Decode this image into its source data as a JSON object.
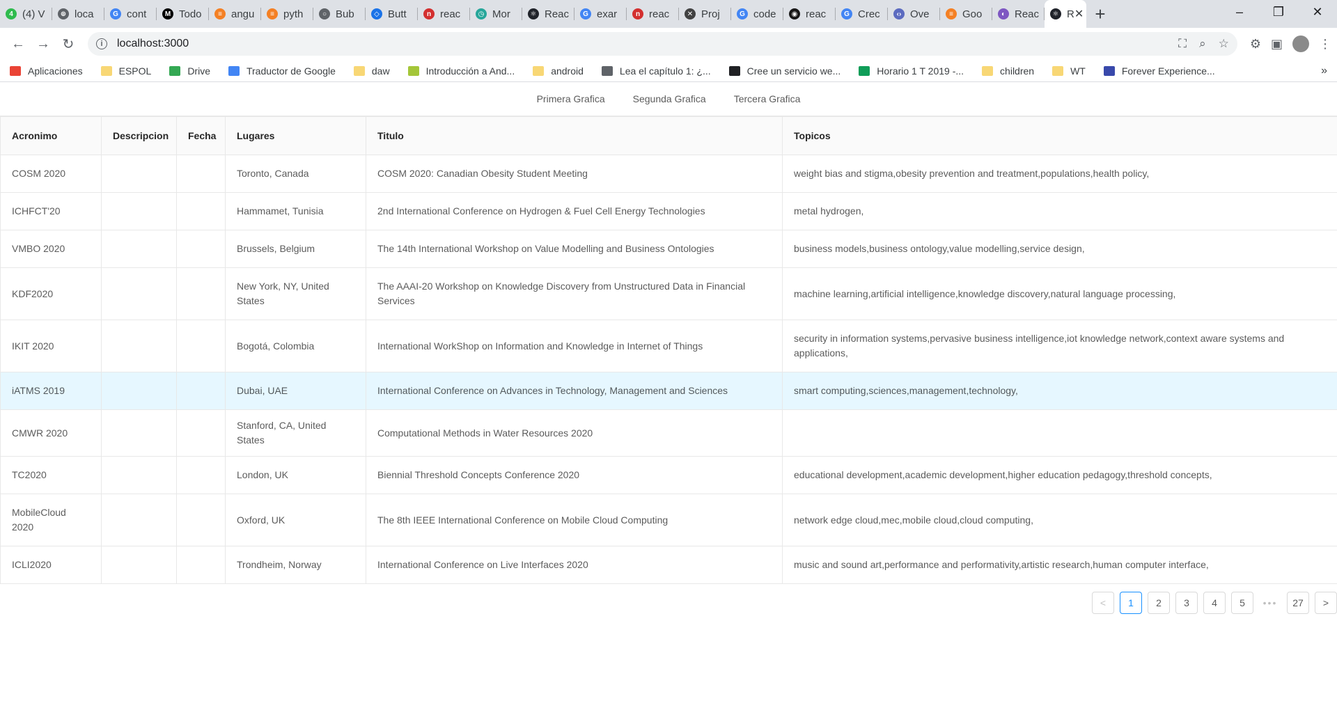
{
  "browser": {
    "tabs": [
      {
        "title": "(4) V",
        "color": "#2fbb4e",
        "glyph": "4"
      },
      {
        "title": "loca",
        "color": "#5f6368",
        "glyph": "⊕"
      },
      {
        "title": "cont",
        "color": "#4285f4",
        "glyph": "G"
      },
      {
        "title": "Todo",
        "color": "#000000",
        "glyph": "M"
      },
      {
        "title": "angu",
        "color": "#f48024",
        "glyph": "≡"
      },
      {
        "title": "pyth",
        "color": "#f48024",
        "glyph": "≡"
      },
      {
        "title": "Bub",
        "color": "#5f6368",
        "glyph": "○"
      },
      {
        "title": "Butt",
        "color": "#1a73e8",
        "glyph": "◇"
      },
      {
        "title": "reac",
        "color": "#d32f2f",
        "glyph": "n"
      },
      {
        "title": "Mor",
        "color": "#26a69a",
        "glyph": "◷"
      },
      {
        "title": "Reac",
        "color": "#20232a",
        "glyph": "⚛"
      },
      {
        "title": "exar",
        "color": "#4285f4",
        "glyph": "G"
      },
      {
        "title": "reac",
        "color": "#d32f2f",
        "glyph": "n"
      },
      {
        "title": "Proj",
        "color": "#424242",
        "glyph": "✕"
      },
      {
        "title": "code",
        "color": "#4285f4",
        "glyph": "G"
      },
      {
        "title": "reac",
        "color": "#181717",
        "glyph": "◉"
      },
      {
        "title": "Crec",
        "color": "#4285f4",
        "glyph": "G"
      },
      {
        "title": "Ove",
        "color": "#5c6bc0",
        "glyph": "‹›"
      },
      {
        "title": "Goo",
        "color": "#f48024",
        "glyph": "≡"
      },
      {
        "title": "Reac",
        "color": "#7e57c2",
        "glyph": "◐"
      }
    ],
    "active_tab": {
      "title": "R",
      "glyph": "⚛",
      "color": "#20232a"
    },
    "url": "localhost:3000",
    "bookmarks": [
      {
        "label": "Aplicaciones",
        "icon": "apps-icon",
        "color": "#ea4335"
      },
      {
        "label": "ESPOL",
        "icon": "folder-icon",
        "color": "#f8d775"
      },
      {
        "label": "Drive",
        "icon": "drive-icon",
        "color": "#34a853"
      },
      {
        "label": "Traductor de Google",
        "icon": "translate-icon",
        "color": "#4285f4"
      },
      {
        "label": "daw",
        "icon": "folder-icon",
        "color": "#f8d775"
      },
      {
        "label": "Introducción a And...",
        "icon": "android-icon",
        "color": "#a4c639"
      },
      {
        "label": "android",
        "icon": "folder-icon",
        "color": "#f8d775"
      },
      {
        "label": "Lea el capítulo 1: ¿...",
        "icon": "cisco-icon",
        "color": "#5f6368"
      },
      {
        "label": "Cree un servicio we...",
        "icon": "paw-icon",
        "color": "#202124"
      },
      {
        "label": "Horario 1 T 2019 -...",
        "icon": "sheets-icon",
        "color": "#0f9d58"
      },
      {
        "label": "children",
        "icon": "folder-icon",
        "color": "#f8d775"
      },
      {
        "label": "WT",
        "icon": "folder-icon",
        "color": "#f8d775"
      },
      {
        "label": "Forever Experience...",
        "icon": "forever-icon",
        "color": "#3949ab"
      }
    ]
  },
  "nav": {
    "links": [
      "Primera Grafica",
      "Segunda Grafica",
      "Tercera Grafica"
    ]
  },
  "table": {
    "columns": [
      "Acronimo",
      "Descripcion",
      "Fecha",
      "Lugares",
      "Titulo",
      "Topicos"
    ],
    "rows": [
      {
        "acronimo": "COSM 2020",
        "descripcion": "",
        "fecha": "",
        "lugares": "Toronto, Canada",
        "titulo": "COSM 2020: Canadian Obesity Student Meeting",
        "topicos": "weight bias and stigma,obesity prevention and treatment,populations,health policy,"
      },
      {
        "acronimo": "ICHFCT'20",
        "descripcion": "",
        "fecha": "",
        "lugares": "Hammamet, Tunisia",
        "titulo": "2nd International Conference on Hydrogen & Fuel Cell Energy Technologies",
        "topicos": "metal hydrogen,"
      },
      {
        "acronimo": "VMBO 2020",
        "descripcion": "",
        "fecha": "",
        "lugares": "Brussels, Belgium",
        "titulo": "The 14th International Workshop on Value Modelling and Business Ontologies",
        "topicos": "business models,business ontology,value modelling,service design,"
      },
      {
        "acronimo": "KDF2020",
        "descripcion": "",
        "fecha": "",
        "lugares": "New York, NY, United States",
        "titulo": "The AAAI-20 Workshop on Knowledge Discovery from Unstructured Data in Financial Services",
        "topicos": "machine learning,artificial intelligence,knowledge discovery,natural language processing,"
      },
      {
        "acronimo": "IKIT 2020",
        "descripcion": "",
        "fecha": "",
        "lugares": "Bogotá, Colombia",
        "titulo": "International WorkShop on Information and Knowledge in Internet of Things",
        "topicos": "security in information systems,pervasive business intelligence,iot knowledge network,context aware systems and applications,"
      },
      {
        "acronimo": "iATMS 2019",
        "descripcion": "",
        "fecha": "",
        "lugares": "Dubai, UAE",
        "titulo": "International Conference on Advances in Technology, Management and Sciences",
        "topicos": "smart computing,sciences,management,technology,"
      },
      {
        "acronimo": "CMWR 2020",
        "descripcion": "",
        "fecha": "",
        "lugares": "Stanford, CA, United States",
        "titulo": "Computational Methods in Water Resources 2020",
        "topicos": ""
      },
      {
        "acronimo": "TC2020",
        "descripcion": "",
        "fecha": "",
        "lugares": "London, UK",
        "titulo": "Biennial Threshold Concepts Conference 2020",
        "topicos": "educational development,academic development,higher education pedagogy,threshold concepts,"
      },
      {
        "acronimo": "MobileCloud 2020",
        "descripcion": "",
        "fecha": "",
        "lugares": "Oxford, UK",
        "titulo": "The 8th IEEE International Conference on Mobile Cloud Computing",
        "topicos": "network edge cloud,mec,mobile cloud,cloud computing,"
      },
      {
        "acronimo": "ICLI2020",
        "descripcion": "",
        "fecha": "",
        "lugares": "Trondheim, Norway",
        "titulo": "International Conference on Live Interfaces 2020",
        "topicos": "music and sound art,performance and performativity,artistic research,human computer interface,"
      }
    ],
    "hover_row": 5,
    "tall_rows": [
      3,
      4,
      8
    ]
  },
  "pagination": {
    "prev": "<",
    "pages": [
      "1",
      "2",
      "3",
      "4",
      "5"
    ],
    "ellipsis": "•••",
    "last": "27",
    "next": ">",
    "current": "1"
  }
}
